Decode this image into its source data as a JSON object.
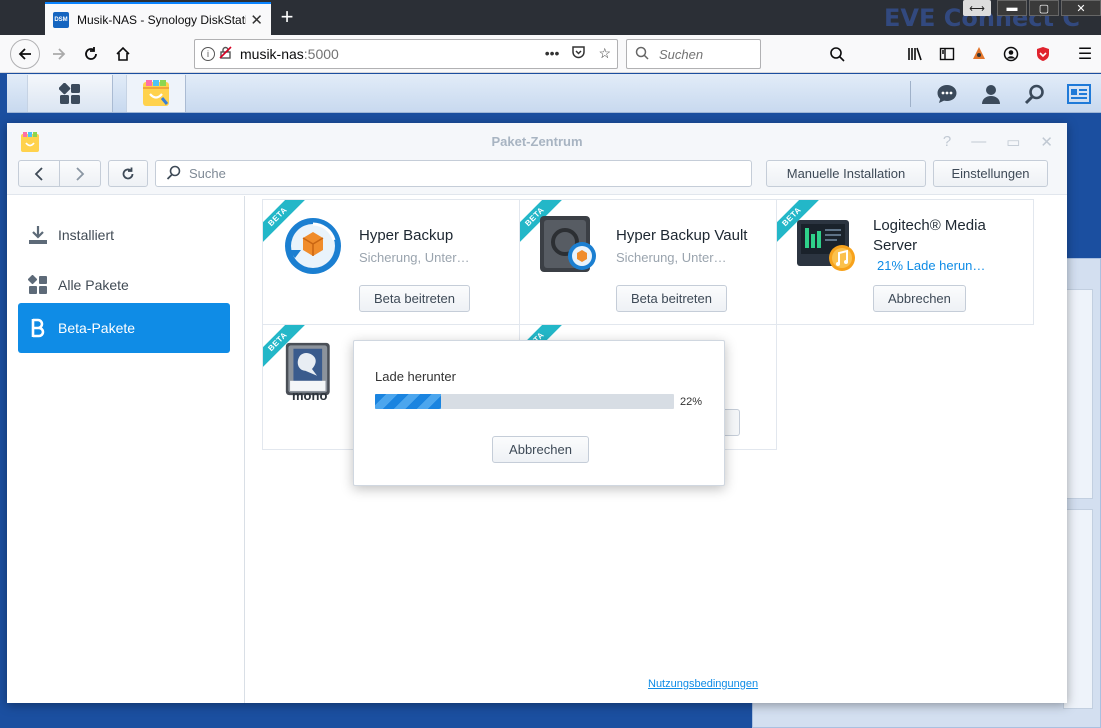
{
  "browser": {
    "tab_title": "Musik-NAS - Synology DiskStation",
    "tab_favicon": "DSM",
    "url_host": "musik-nas",
    "url_port": ":5000",
    "search_placeholder": "Suchen",
    "desktop_text": "EVE Connect C"
  },
  "dsm": {
    "taskbar_icons": [
      "main-menu-icon",
      "package-center-icon",
      "chat-icon",
      "user-icon",
      "search-icon",
      "widgets-icon"
    ]
  },
  "window": {
    "title": "Paket-Zentrum",
    "search_placeholder": "Suche",
    "manual_install_label": "Manuelle Installation",
    "settings_label": "Einstellungen",
    "terms_link": "Nutzungsbedingungen"
  },
  "sidebar": {
    "items": [
      {
        "label": "Installiert",
        "icon": "download-icon"
      },
      {
        "label": "Alle Pakete",
        "icon": "grid-icon"
      },
      {
        "label": "Beta-Pakete",
        "icon": "beta-icon",
        "active": true
      }
    ]
  },
  "packages": [
    {
      "name": "Hyper Backup",
      "desc": "Sicherung, Unter…",
      "button": "Beta beitreten",
      "badge": "BETA"
    },
    {
      "name": "Hyper Backup Vault",
      "desc": "Sicherung, Unter…",
      "button": "Beta beitreten",
      "badge": "BETA"
    },
    {
      "name": "Logitech® Media Server",
      "progress_text": "21% Lade herun…",
      "button": "Abbrechen",
      "badge": "BETA"
    },
    {
      "name": "",
      "badge": "BETA",
      "icon_text": "mono"
    },
    {
      "name": "",
      "badge": "BETA"
    }
  ],
  "dialog": {
    "label": "Lade herunter",
    "percent_text": "22%",
    "progress": 0.22,
    "button": "Abbrechen"
  },
  "colors": {
    "accent": "#0f8ce6",
    "beta_ribbon": "#23b7c8",
    "desktop": "#1b4fa0"
  }
}
